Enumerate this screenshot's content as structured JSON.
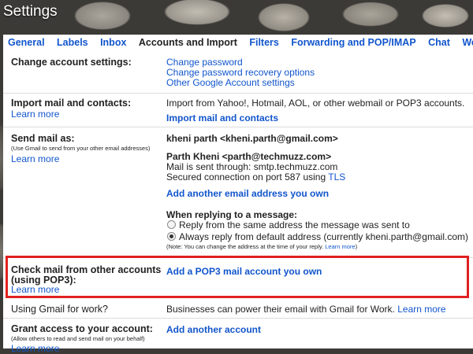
{
  "window": {
    "title": "Settings"
  },
  "tabs": [
    {
      "label": "General"
    },
    {
      "label": "Labels"
    },
    {
      "label": "Inbox"
    },
    {
      "label": "Accounts and Import"
    },
    {
      "label": "Filters"
    },
    {
      "label": "Forwarding and POP/IMAP"
    },
    {
      "label": "Chat"
    },
    {
      "label": "Web Clips"
    }
  ],
  "change_account": {
    "label": "Change account settings:",
    "links": [
      "Change password",
      "Change password recovery options",
      "Other Google Account settings"
    ]
  },
  "import_mail": {
    "label": "Import mail and contacts:",
    "learn_more": "Learn more",
    "description": "Import from Yahoo!, Hotmail, AOL, or other webmail or POP3 accounts.",
    "action": "Import mail and contacts"
  },
  "send_mail": {
    "label": "Send mail as:",
    "sub": "(Use Gmail to send from your other email addresses)",
    "learn_more": "Learn more",
    "primary_address": "kheni parth <kheni.parth@gmail.com>",
    "secondary_address": "Parth Kheni <parth@techmuzz.com>",
    "sent_through": "Mail is sent through: smtp.techmuzz.com",
    "secured_prefix": "Secured connection on port 587 using ",
    "secured_link": "TLS",
    "add_address": "Add another email address you own",
    "reply_heading": "When replying to a message:",
    "reply_option_1": "Reply from the same address the message was sent to",
    "reply_option_2": "Always reply from default address (currently kheni.parth@gmail.com)",
    "note_prefix": "(Note: You can change the address at the time of your reply. ",
    "note_link": "Learn more",
    "note_suffix": ")"
  },
  "check_mail": {
    "label_line1": "Check mail from other accounts",
    "label_line2": "(using POP3):",
    "learn_more": "Learn more",
    "action": "Add a POP3 mail account you own"
  },
  "gmail_work": {
    "label": "Using Gmail for work?",
    "description": "Businesses can power their email with Gmail for Work. ",
    "learn_more": "Learn more"
  },
  "grant_access": {
    "label": "Grant access to your account:",
    "sub": "(Allow others to read and send mail on your behalf)",
    "learn_more": "Learn more",
    "action": "Add another account"
  },
  "colors": {
    "link": "#1155cc",
    "highlight": "#e02020",
    "text": "#222222"
  }
}
